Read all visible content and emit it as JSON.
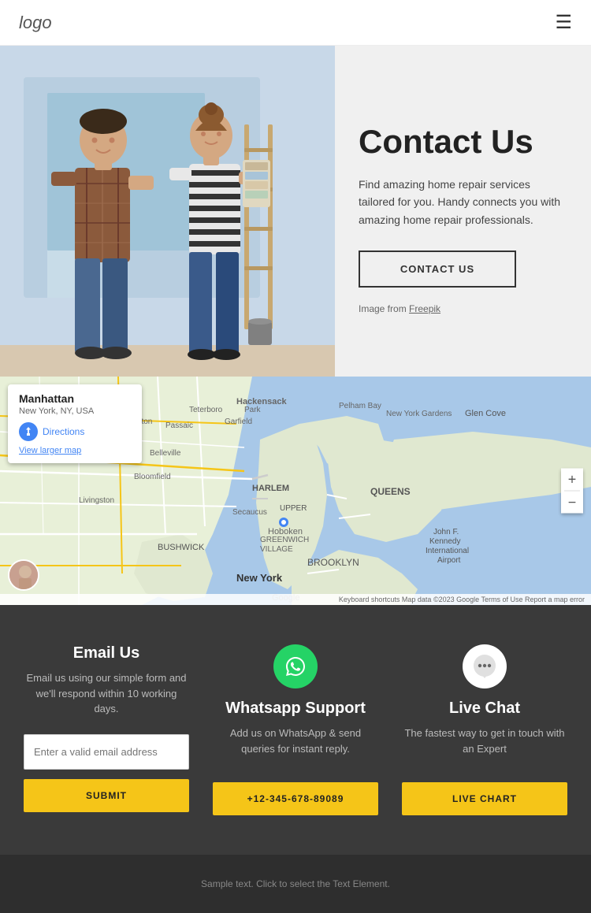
{
  "navbar": {
    "logo_text": "logo",
    "hamburger_icon": "☰"
  },
  "hero": {
    "title": "Contact Us",
    "description": "Find amazing home repair services tailored for you. Handy connects you with amazing home repair professionals.",
    "cta_button": "CONTACT US",
    "image_credit_prefix": "Image from ",
    "image_credit_link": "Freepik"
  },
  "map": {
    "location_name": "Manhattan",
    "location_sub": "New York, NY, USA",
    "directions_label": "Directions",
    "larger_map_link": "View larger map",
    "zoom_in": "+",
    "zoom_out": "−",
    "attribution": "Keyboard shortcuts   Map data ©2023 Google   Terms of Use   Report a map error"
  },
  "contact_section": {
    "email_col": {
      "title": "Email Us",
      "description": "Email us using our simple form and we'll respond within 10 working days.",
      "input_placeholder": "Enter a valid email address",
      "button_label": "SUBMIT"
    },
    "whatsapp_col": {
      "title": "Whatsapp Support",
      "description": "Add us on WhatsApp & send queries for instant reply.",
      "button_label": "+12-345-678-89089",
      "icon": "📞"
    },
    "livechat_col": {
      "title": "Live Chat",
      "description": "The fastest way to get in touch with an Expert",
      "button_label": "LIVE CHART",
      "icon": "💬"
    }
  },
  "footer": {
    "text": "Sample text. Click to select the Text Element."
  }
}
